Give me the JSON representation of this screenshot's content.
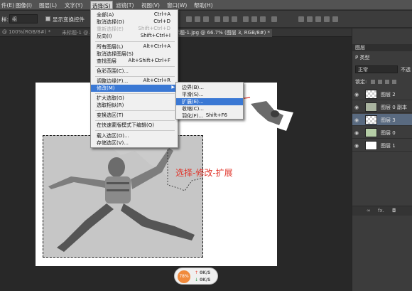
{
  "menubar": {
    "items": [
      "件(E)",
      "图像(I)",
      "图层(L)",
      "文字(Y)",
      "选择(S)",
      "滤镜(T)",
      "视图(V)",
      "窗口(W)",
      "帮助(H)"
    ]
  },
  "options_bar": {
    "prefix": "样:",
    "sample_value": "组",
    "checkbox_label": "显示变换控件"
  },
  "tabs": [
    "@ 100%(RGB/8#) *",
    "未标题-1 @...",
    "标题-1.jpg @ 66.7% (图层 3, RGB/8#) *"
  ],
  "select_menu": {
    "items": [
      {
        "label": "全部(A)",
        "shortcut": "Ctrl+A",
        "disabled": false
      },
      {
        "label": "取消选择(D)",
        "shortcut": "Ctrl+D",
        "disabled": false
      },
      {
        "label": "重新选择(E)",
        "shortcut": "Shift+Ctrl+D",
        "disabled": true
      },
      {
        "label": "反向(I)",
        "shortcut": "Shift+Ctrl+I",
        "disabled": false
      },
      {
        "label": "所有图层(L)",
        "shortcut": "Alt+Ctrl+A",
        "disabled": false
      },
      {
        "label": "取消选择图层(S)",
        "shortcut": "",
        "disabled": false
      },
      {
        "label": "查找图层",
        "shortcut": "Alt+Shift+Ctrl+F",
        "disabled": false
      },
      {
        "label": "色彩范围(C)...",
        "shortcut": "",
        "disabled": false
      },
      {
        "label": "调整边缘(F)...",
        "shortcut": "Alt+Ctrl+R",
        "disabled": false
      },
      {
        "label": "修改(M)",
        "shortcut": "",
        "disabled": false
      },
      {
        "label": "扩大选取(G)",
        "shortcut": "",
        "disabled": false
      },
      {
        "label": "选取相似(R)",
        "shortcut": "",
        "disabled": false
      },
      {
        "label": "变换选区(T)",
        "shortcut": "",
        "disabled": false
      },
      {
        "label": "在快速蒙版模式下编辑(Q)",
        "shortcut": "",
        "disabled": false
      },
      {
        "label": "载入选区(O)...",
        "shortcut": "",
        "disabled": false
      },
      {
        "label": "存储选区(V)...",
        "shortcut": "",
        "disabled": false
      }
    ]
  },
  "modify_menu": {
    "items": [
      {
        "label": "边界(B)...",
        "shortcut": ""
      },
      {
        "label": "平滑(S)...",
        "shortcut": ""
      },
      {
        "label": "扩展(E)...",
        "shortcut": ""
      },
      {
        "label": "收缩(C)...",
        "shortcut": ""
      },
      {
        "label": "羽化(F)...",
        "shortcut": "Shift+F6"
      }
    ],
    "highlighted_index": 2
  },
  "annotation": "选择-修改-扩展",
  "status_bubble": {
    "percent": "78%",
    "up": "0K/S",
    "down": "0K/S"
  },
  "layers_panel": {
    "title": "图层",
    "kind_label": "P 类型",
    "blend_mode": "正常",
    "opacity_label": "不透",
    "lock_label": "锁定:",
    "layers": [
      {
        "name": "图层 2",
        "selected": false,
        "thumb": "checker"
      },
      {
        "name": "图层 0 副本",
        "selected": false,
        "thumb": "photo"
      },
      {
        "name": "图层 3",
        "selected": true,
        "thumb": "checker"
      },
      {
        "name": "图层 0",
        "selected": false,
        "thumb": "photo"
      },
      {
        "name": "图层 1",
        "selected": false,
        "thumb": "white"
      }
    ],
    "bottom_icons": [
      "link-icon",
      "fx-icon",
      "mask-icon"
    ],
    "fx_label": "fx."
  },
  "colors": {
    "highlight": "#3a78d4",
    "annotation": "#e0352b",
    "menubar": "#535353"
  }
}
